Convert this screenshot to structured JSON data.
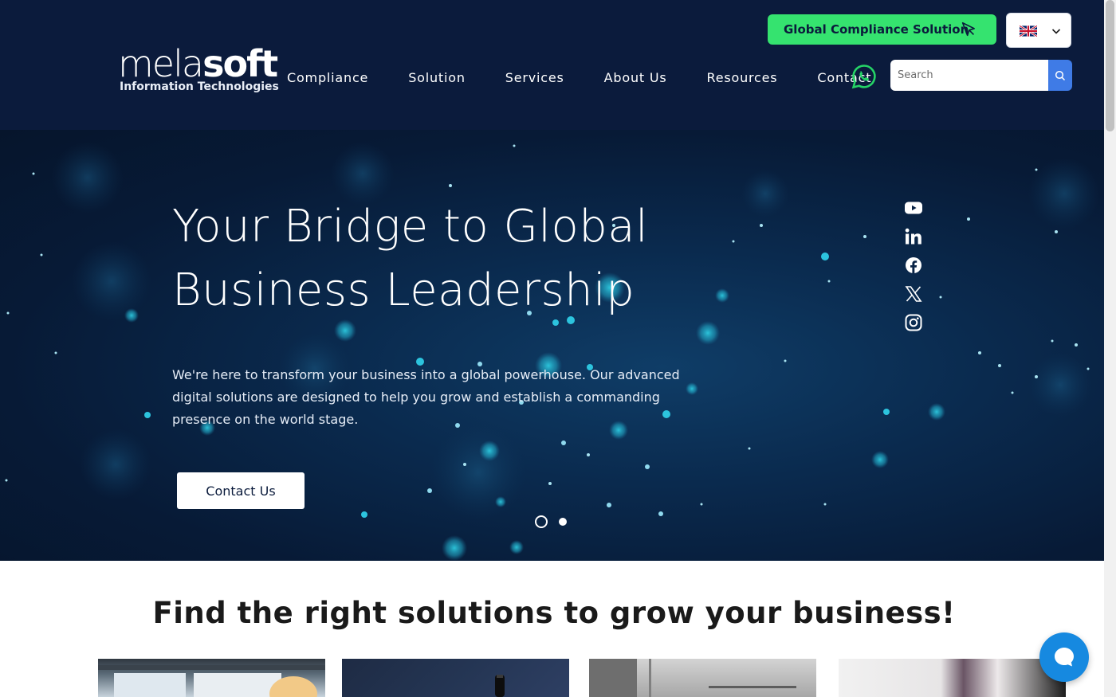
{
  "header": {
    "logo_text_light": "mela",
    "logo_text_bold": "soft",
    "logo_subtitle": "Information Technologies",
    "nav": [
      {
        "label": "Compliance"
      },
      {
        "label": "Solution"
      },
      {
        "label": "Services"
      },
      {
        "label": "About Us"
      },
      {
        "label": "Resources"
      },
      {
        "label": "Contact"
      }
    ],
    "cta_label": "Global Compliance Solution",
    "language_icon": "uk-flag-icon",
    "search_placeholder": "Search",
    "colors": {
      "header_bg": "#0b1b3c",
      "cta_green": "#35e36f",
      "search_button": "#3f7be6",
      "whatsapp_green": "#25d366"
    }
  },
  "hero": {
    "title": "Your Bridge to Global Business Leadership",
    "text": "We're here to transform your business into a global powerhouse. Our advanced digital solutions are designed to help you grow and establish a commanding presence on the world stage.",
    "cta_label": "Contact Us",
    "slides_total": 2,
    "active_slide": 1,
    "social_icons": [
      "youtube-icon",
      "linkedin-icon",
      "facebook-icon",
      "x-icon",
      "instagram-icon"
    ]
  },
  "section": {
    "title": "Find the right solutions to grow your business!"
  },
  "chat": {
    "icon": "chat-bubble-icon",
    "color": "#1689e0"
  }
}
